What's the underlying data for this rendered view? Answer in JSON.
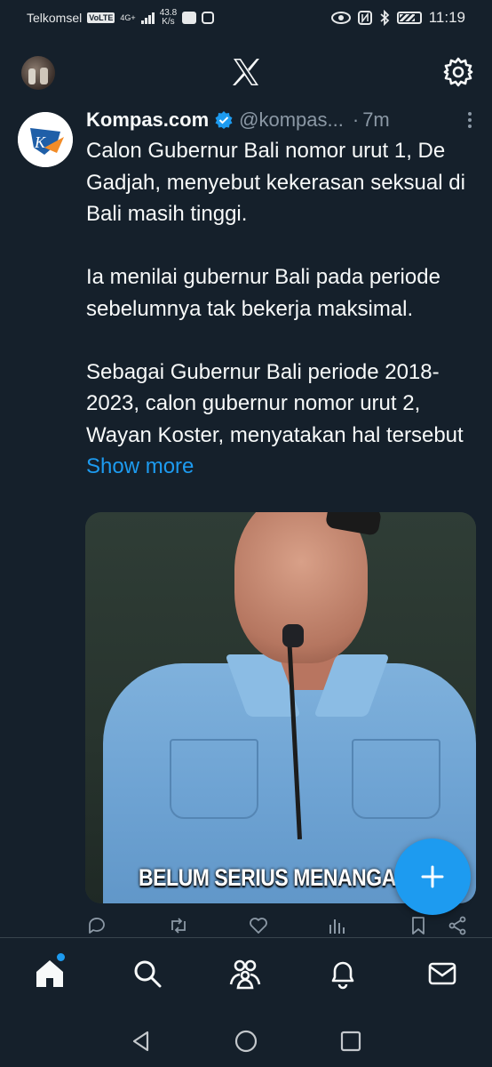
{
  "status_bar": {
    "carrier": "Telkomsel",
    "volte": "VoLTE",
    "network": "4G+",
    "speed_value": "43.8",
    "speed_unit": "K/s",
    "time": "11:19"
  },
  "header": {
    "logo_icon": "x-logo",
    "settings_icon": "gear-icon"
  },
  "tweet": {
    "author_name": "Kompas.com",
    "author_handle": "@kompas...",
    "separator": "·",
    "time": "7m",
    "paragraphs": [
      "Calon Gubernur Bali nomor urut 1, De Gadjah, menyebut kekerasan seksual di Bali masih tinggi.",
      "Ia menilai gubernur Bali pada periode sebelumnya tak bekerja maksimal.",
      "Sebagai Gubernur Bali periode 2018-2023, calon gubernur nomor urut 2, Wayan Koster, menyatakan hal tersebut"
    ],
    "show_more": "Show more",
    "media_caption": "BELUM SERIUS MENANGA"
  },
  "colors": {
    "background": "#15202b",
    "accent": "#1d9bf0",
    "secondary_text": "#8b98a5"
  },
  "actions": [
    "reply-icon",
    "retweet-icon",
    "like-icon",
    "views-icon",
    "bookmark-icon",
    "share-icon"
  ],
  "bottom_nav": [
    "home-icon",
    "search-icon",
    "communities-icon",
    "notifications-icon",
    "messages-icon"
  ],
  "android_nav": [
    "back-icon",
    "home-circle-icon",
    "recents-icon"
  ]
}
